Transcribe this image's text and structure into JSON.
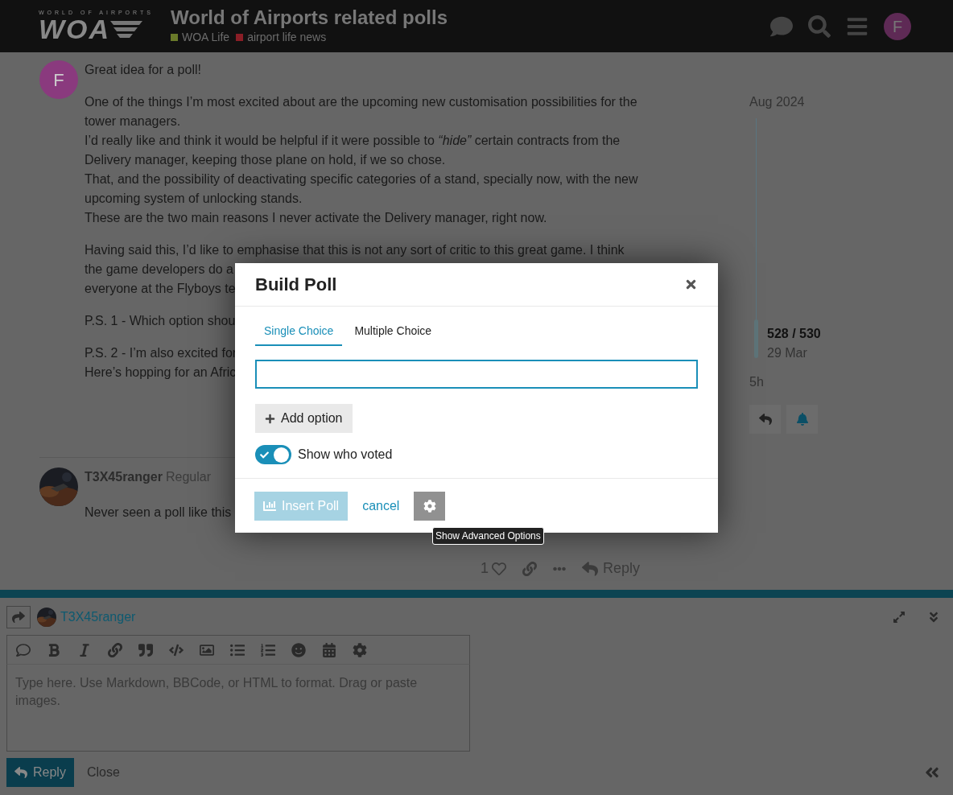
{
  "header": {
    "logo": {
      "tagline": "WORLD OF AIRPORTS",
      "mark": "WOA"
    },
    "title": "World of Airports related polls",
    "categories": [
      {
        "name": "WOA Life",
        "color": "#6a7a2a"
      },
      {
        "name": "airport life news",
        "color": "#8a1e26"
      }
    ],
    "avatar": "F"
  },
  "posts": [
    {
      "avatar": "F",
      "paragraphs": [
        [
          "Great idea for a poll!"
        ],
        [
          "One of the things I’m most excited about are the upcoming new customisation possibilities for the tower managers.",
          "I’d really like and think it would be helpful if it were possible to *“hide”* certain contracts from the Delivery manager, keeping those plane on hold, if we so chose.",
          "That, and the possibility of deactivating specific categories of a stand, specially now, with the new upcoming system of unlocking stands.",
          "These are the two main reasons I never activate the Delivery manager, right now."
        ],
        [
          "Having said this, I’d like to emphasise that this is not any sort of critic to this great game. I think",
          "the game developers do a",
          "everyone at the Flyboys te"
        ],
        [
          "P.S. 1 - Which option shou"
        ],
        [
          "P.S. 2 - I’m also excited for",
          "Here’s hopping for an Afric"
        ]
      ]
    },
    {
      "author": "T3X45ranger",
      "rank": "Regular",
      "paragraphs": [
        [
          "Never seen a poll like this"
        ]
      ],
      "likes": "1",
      "reply": "Reply"
    }
  ],
  "timeline": {
    "start": "Aug 2024",
    "position": "528 / 530",
    "date": "29 Mar",
    "end": "5h"
  },
  "composer": {
    "user": "T3X45ranger",
    "placeholder": "Type here. Use Markdown, BBCode, or HTML to format. Drag or paste images.",
    "reply": "Reply",
    "close": "Close"
  },
  "modal": {
    "title": "Build Poll",
    "tabs": [
      {
        "label": "Single Choice",
        "selected": true
      },
      {
        "label": "Multiple Choice",
        "selected": false
      }
    ],
    "add_option": "Add option",
    "toggle": {
      "label": "Show who voted",
      "on": true
    },
    "insert": {
      "label": "Insert Poll",
      "disabled": true
    },
    "cancel": "cancel",
    "tooltip": "Show Advanced Options"
  }
}
